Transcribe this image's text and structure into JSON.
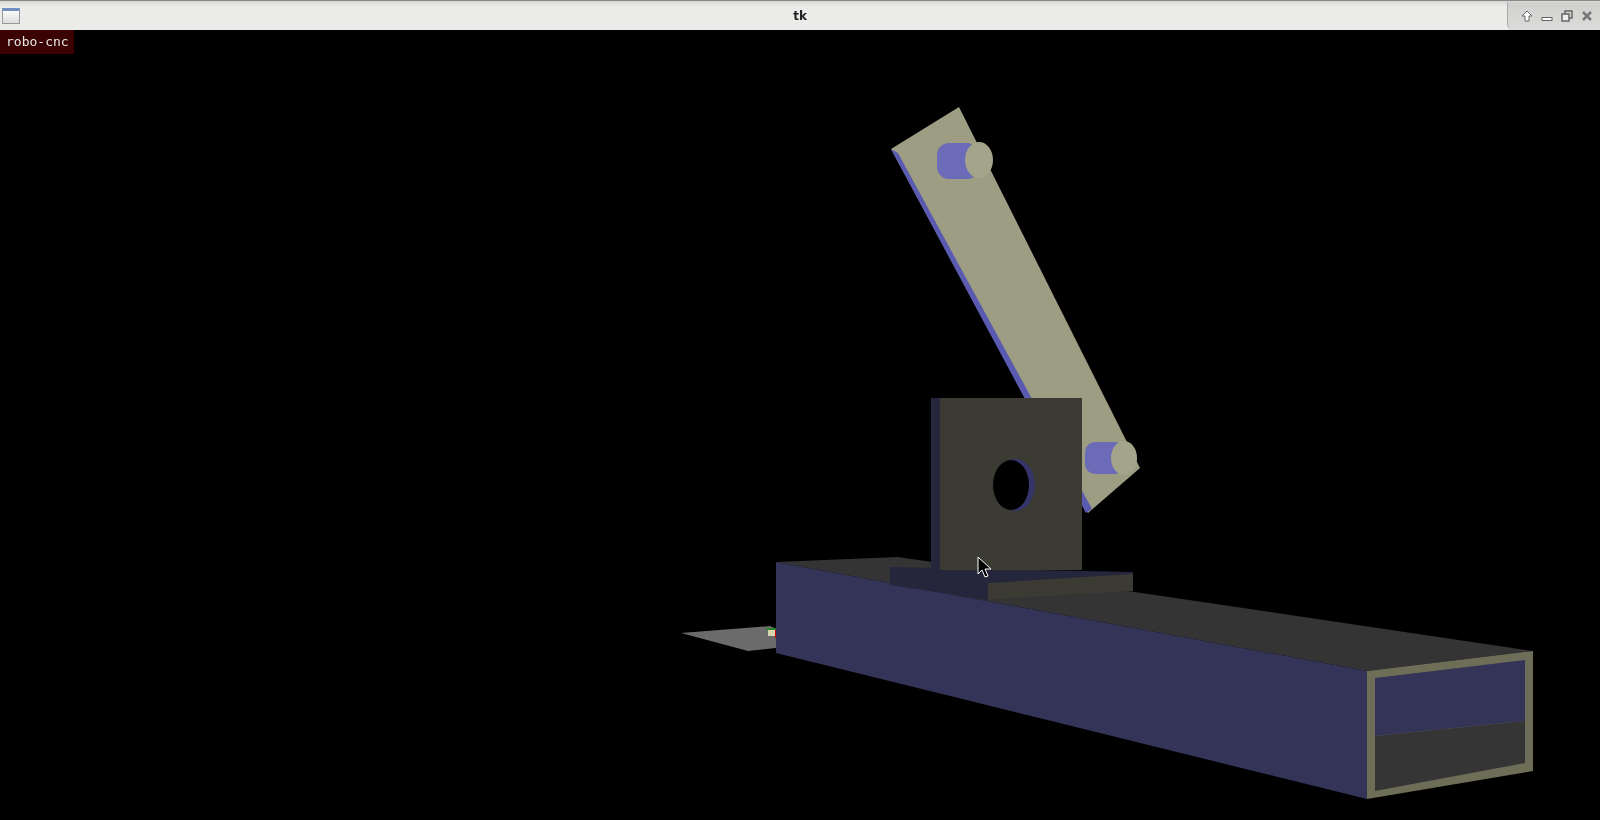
{
  "window": {
    "title": "tk"
  },
  "viewport": {
    "label": "robo-cnc"
  }
}
